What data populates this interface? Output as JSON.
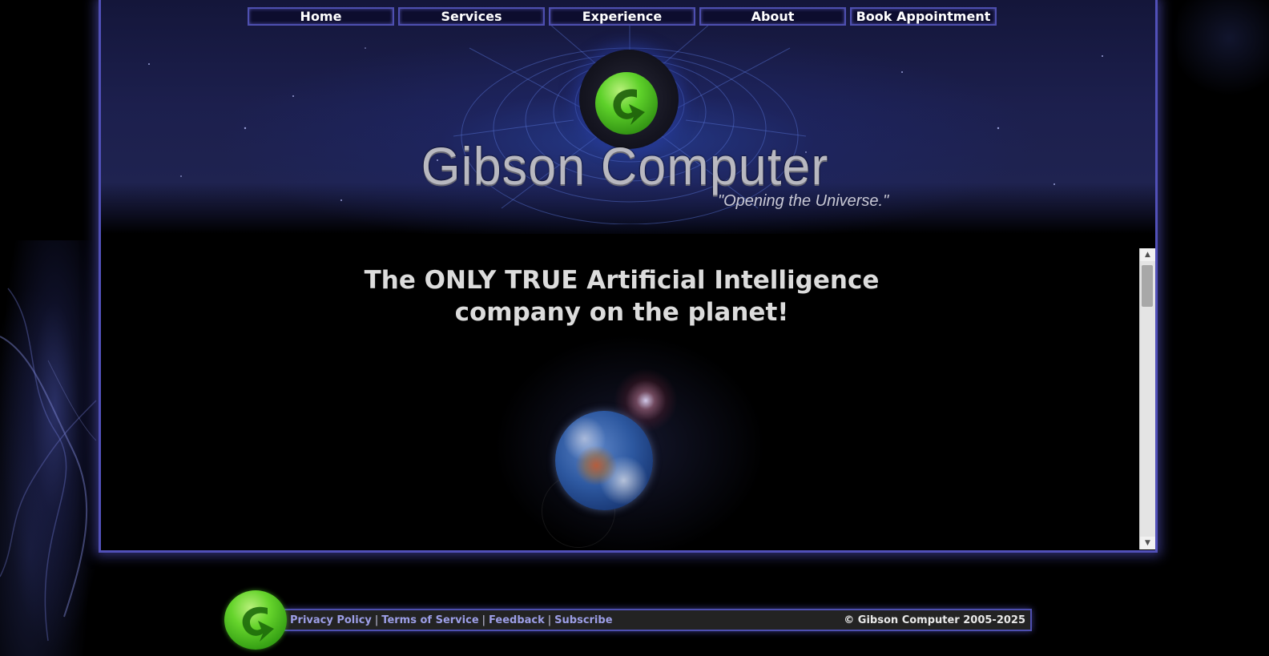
{
  "nav": {
    "items": [
      {
        "label": "Home"
      },
      {
        "label": "Services"
      },
      {
        "label": "Experience"
      },
      {
        "label": "About"
      },
      {
        "label": "Book Appointment"
      }
    ]
  },
  "header": {
    "brand_name": "Gibson Computer",
    "tagline": "\"Opening the Universe.\"",
    "logo_icon": "green-arrow-orb-icon"
  },
  "main": {
    "headline_line1": "The ONLY TRUE Artificial Intelligence",
    "headline_line2": "company on the planet!",
    "image_icon": "earth-icon"
  },
  "scrollbar": {
    "up_glyph": "▲",
    "down_glyph": "▼"
  },
  "footer": {
    "links": [
      {
        "label": "Privacy Policy"
      },
      {
        "label": "Terms of Service"
      },
      {
        "label": "Feedback"
      },
      {
        "label": "Subscribe"
      }
    ],
    "separator": "|",
    "copyright": "© Gibson Computer 2005-2025"
  },
  "colors": {
    "accent_border": "#5150b8",
    "logo_green": "#5ed12a",
    "link": "#9c9ee6"
  }
}
